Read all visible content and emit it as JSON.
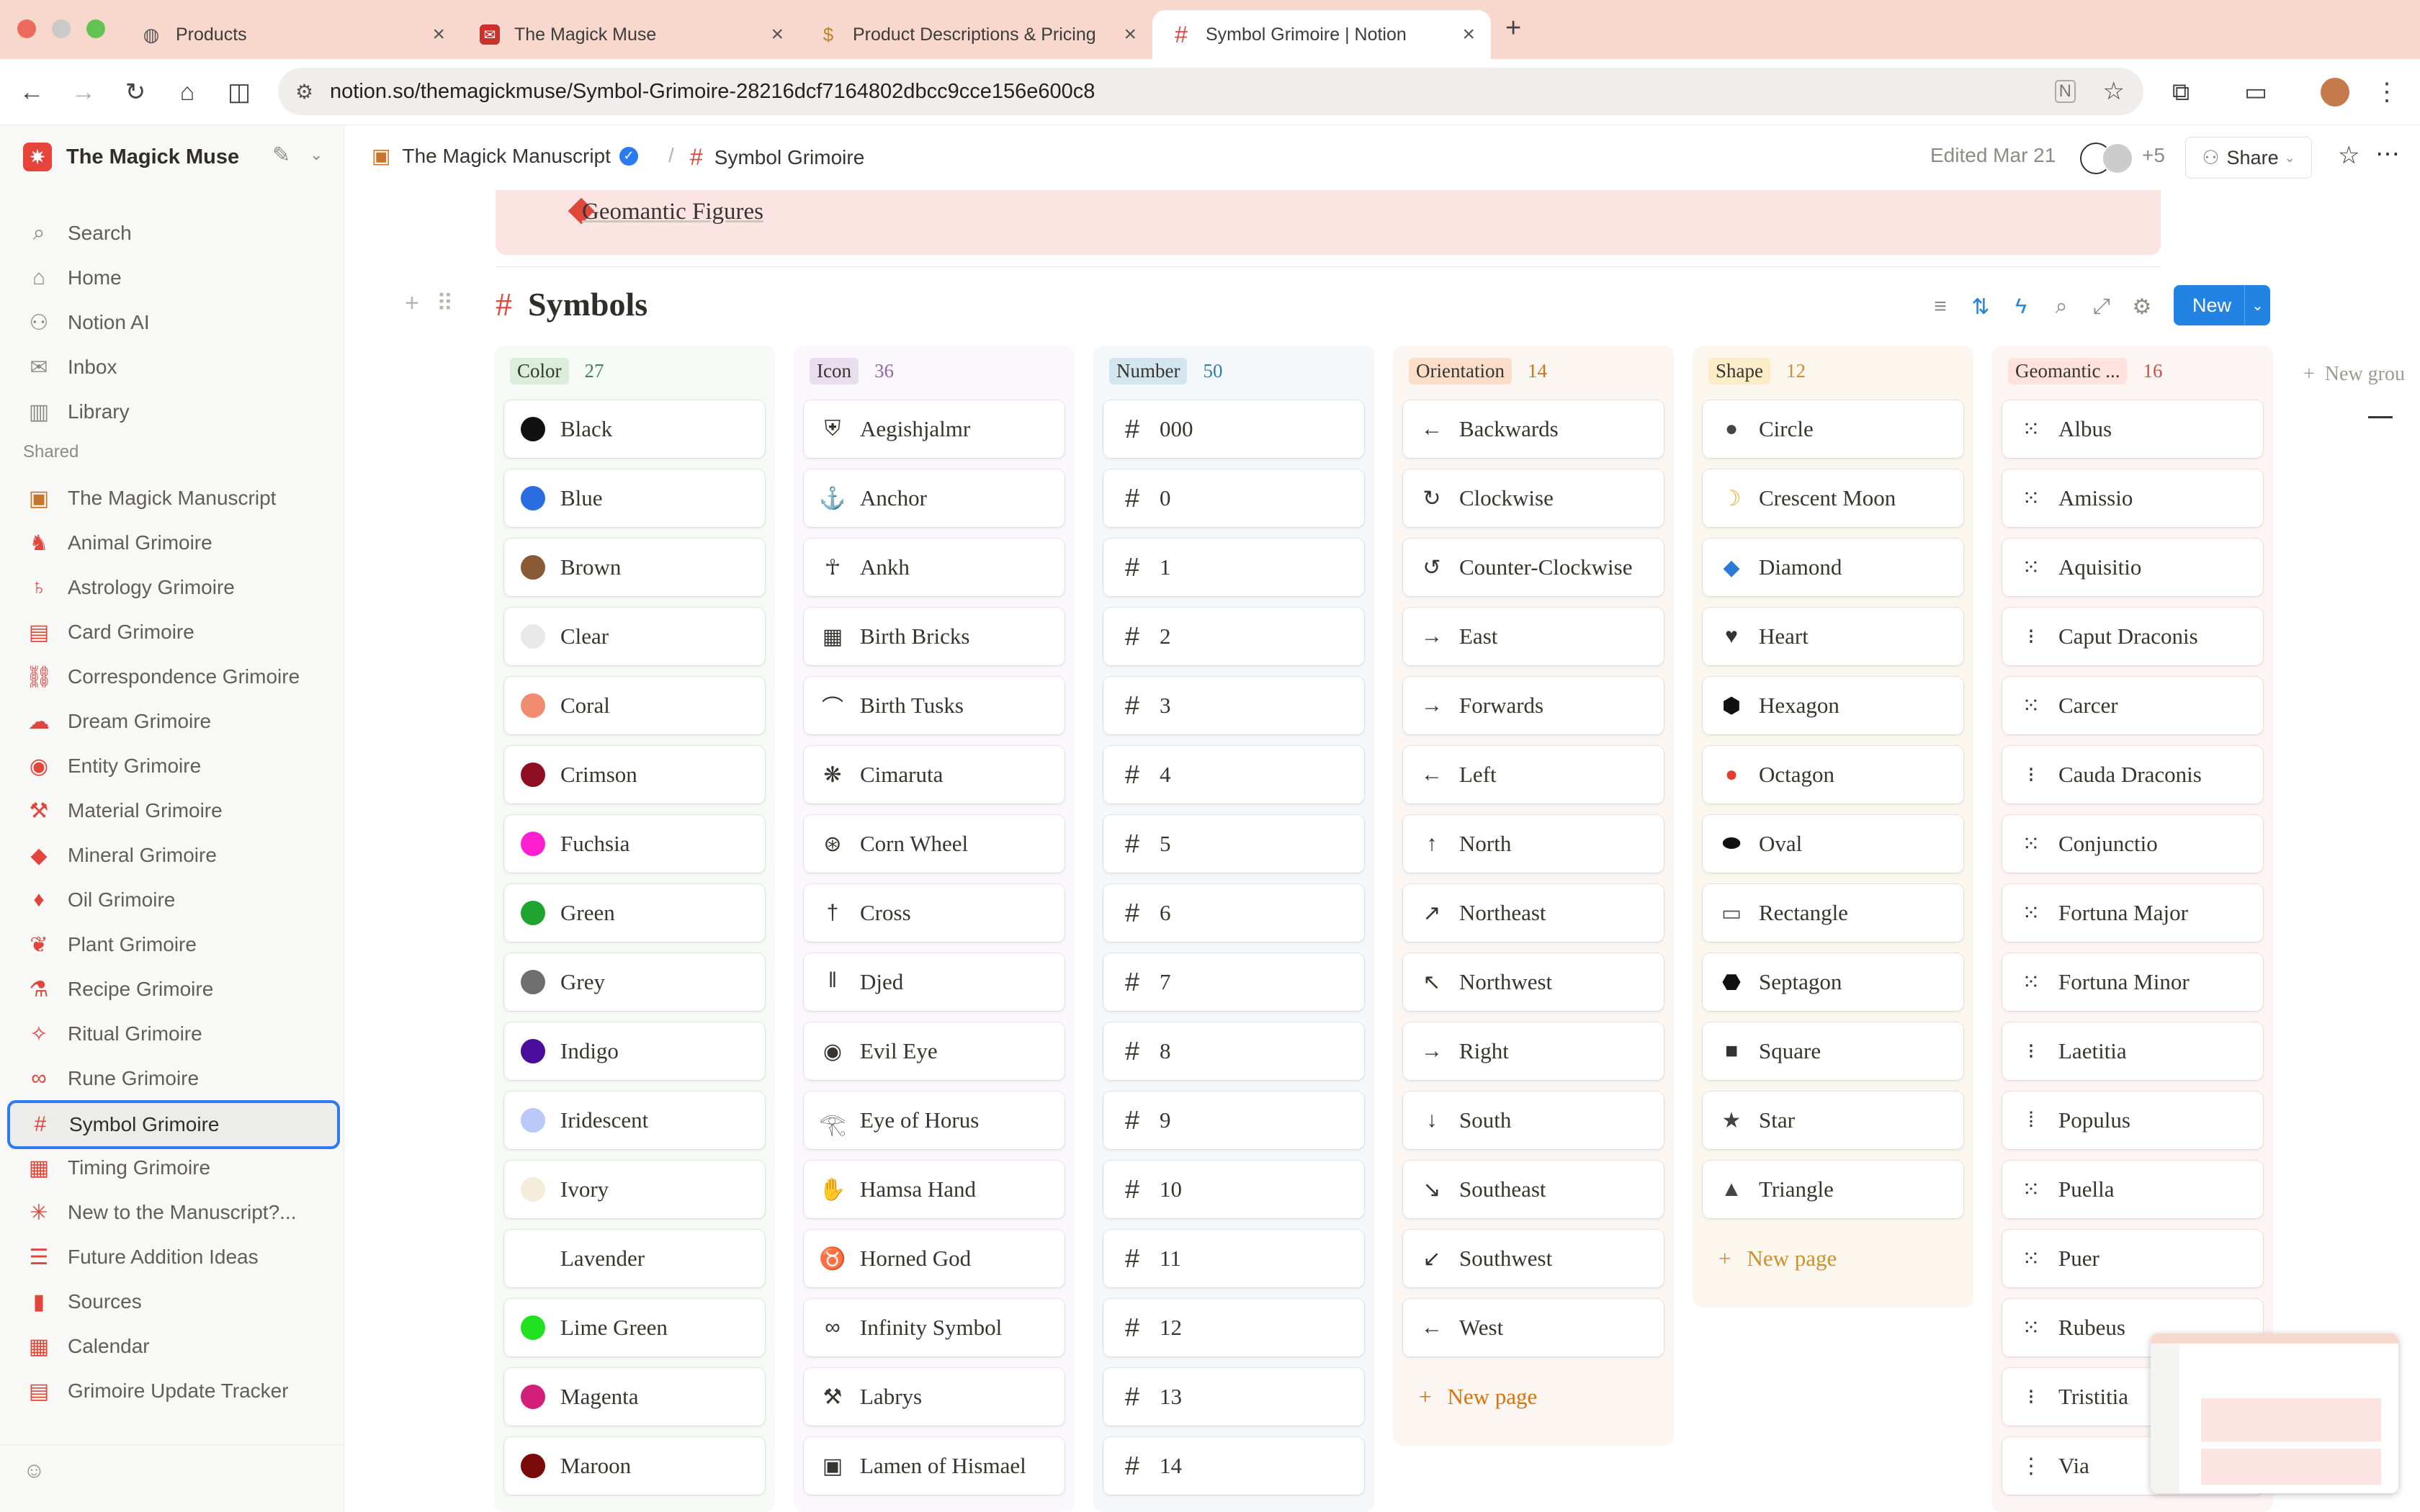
{
  "browser": {
    "tabs": [
      {
        "label": "Products",
        "icon": "globe-icon"
      },
      {
        "label": "The Magick Muse",
        "icon": "magick-muse-icon"
      },
      {
        "label": "Product Descriptions & Pricing",
        "icon": "money-bag-icon"
      },
      {
        "label": "Symbol Grimoire | Notion",
        "icon": "hash-icon"
      }
    ],
    "url": "notion.so/themagickmuse/Symbol-Grimoire-28216dcf7164802dbcc9cce156e600c8"
  },
  "sidebar": {
    "workspace": "The Magick Muse",
    "nav": [
      {
        "label": "Search",
        "icon": "search-icon"
      },
      {
        "label": "Home",
        "icon": "home-icon"
      },
      {
        "label": "Notion AI",
        "icon": "notion-ai-icon"
      },
      {
        "label": "Inbox",
        "icon": "inbox-icon"
      },
      {
        "label": "Library",
        "icon": "library-icon"
      }
    ],
    "shared_label": "Shared",
    "shared": [
      {
        "label": "The Magick Manuscript",
        "icon": "treasure-chest-icon"
      },
      {
        "label": "Animal Grimoire",
        "icon": "animal-icon"
      },
      {
        "label": "Astrology Grimoire",
        "icon": "planet-icon"
      },
      {
        "label": "Card Grimoire",
        "icon": "cards-icon"
      },
      {
        "label": "Correspondence Grimoire",
        "icon": "link-icon"
      },
      {
        "label": "Dream Grimoire",
        "icon": "cloud-icon"
      },
      {
        "label": "Entity Grimoire",
        "icon": "eye-icon"
      },
      {
        "label": "Material Grimoire",
        "icon": "wrench-icon"
      },
      {
        "label": "Mineral Grimoire",
        "icon": "gem-icon"
      },
      {
        "label": "Oil Grimoire",
        "icon": "drop-icon"
      },
      {
        "label": "Plant Grimoire",
        "icon": "leaf-icon"
      },
      {
        "label": "Recipe Grimoire",
        "icon": "flask-icon"
      },
      {
        "label": "Ritual Grimoire",
        "icon": "wand-icon"
      },
      {
        "label": "Rune Grimoire",
        "icon": "infinity-icon"
      },
      {
        "label": "Symbol Grimoire",
        "icon": "hash-icon"
      },
      {
        "label": "Timing Grimoire",
        "icon": "calendar-icon"
      },
      {
        "label": "New to the Manuscript?...",
        "icon": "sparkle-icon"
      },
      {
        "label": "Future Addition Ideas",
        "icon": "list-icon"
      },
      {
        "label": "Sources",
        "icon": "book-icon"
      },
      {
        "label": "Calendar",
        "icon": "calendar-icon"
      },
      {
        "label": "Grimoire Update Tracker",
        "icon": "tracker-icon"
      }
    ]
  },
  "header": {
    "crumb1": "The Magick Manuscript",
    "crumb_sep": "/",
    "crumb2": "Symbol Grimoire",
    "edited": "Edited Mar 21",
    "avatars_more": "+5",
    "share": "Share"
  },
  "callout_item": "Geomantic Figures",
  "database": {
    "title": "Symbols",
    "new_label": "New",
    "new_group": "New grou",
    "new_page": "New page",
    "columns": [
      {
        "name": "Color",
        "count": "27",
        "pill_bg": "#dbeddb",
        "bg": "#f6faf6",
        "count_color": "#448361",
        "items": [
          {
            "label": "Black",
            "swatch": "#111111"
          },
          {
            "label": "Blue",
            "swatch": "#2a6de0"
          },
          {
            "label": "Brown",
            "swatch": "#8a5a34"
          },
          {
            "label": "Clear",
            "swatch": "#e9e9ea"
          },
          {
            "label": "Coral",
            "swatch": "#f08d70"
          },
          {
            "label": "Crimson",
            "swatch": "#8d0e22"
          },
          {
            "label": "Fuchsia",
            "swatch": "#ff1ed0"
          },
          {
            "label": "Green",
            "swatch": "#1fa331"
          },
          {
            "label": "Grey",
            "swatch": "#6e6e6e"
          },
          {
            "label": "Indigo",
            "swatch": "#4a0c9a"
          },
          {
            "label": "Iridescent",
            "swatch": "#b9c8f7"
          },
          {
            "label": "Ivory",
            "swatch": "#f5ecdc"
          },
          {
            "label": "Lavender",
            "swatch": ""
          },
          {
            "label": "Lime Green",
            "swatch": "#1fe11f"
          },
          {
            "label": "Magenta",
            "swatch": "#d11e78"
          },
          {
            "label": "Maroon",
            "swatch": "#7a0b0b"
          }
        ]
      },
      {
        "name": "Icon",
        "count": "36",
        "pill_bg": "#e8deee",
        "bg": "#faf8fc",
        "count_color": "#9065b0",
        "items": [
          {
            "label": "Aegishjalmr",
            "glyph": "⛨"
          },
          {
            "label": "Anchor",
            "glyph": "⚓"
          },
          {
            "label": "Ankh",
            "glyph": "☥"
          },
          {
            "label": "Birth Bricks",
            "glyph": "▦"
          },
          {
            "label": "Birth Tusks",
            "glyph": "⌒"
          },
          {
            "label": "Cimaruta",
            "glyph": "❋"
          },
          {
            "label": "Corn Wheel",
            "glyph": "⊛"
          },
          {
            "label": "Cross",
            "glyph": "†"
          },
          {
            "label": "Djed",
            "glyph": "𝍪"
          },
          {
            "label": "Evil Eye",
            "glyph": "◉"
          },
          {
            "label": "Eye of Horus",
            "glyph": "𓂀"
          },
          {
            "label": "Hamsa Hand",
            "glyph": "✋"
          },
          {
            "label": "Horned God",
            "glyph": "♉"
          },
          {
            "label": "Infinity Symbol",
            "glyph": "∞"
          },
          {
            "label": "Labrys",
            "glyph": "⚒"
          },
          {
            "label": "Lamen of Hismael",
            "glyph": "▣"
          }
        ]
      },
      {
        "name": "Number",
        "count": "50",
        "pill_bg": "#d3e5ef",
        "bg": "#f4f8fb",
        "count_color": "#337ea9",
        "items": [
          "000",
          "0",
          "1",
          "2",
          "3",
          "4",
          "5",
          "6",
          "7",
          "8",
          "9",
          "10",
          "11",
          "12",
          "13",
          "14"
        ]
      },
      {
        "name": "Orientation",
        "count": "14",
        "pill_bg": "#fadec9",
        "bg": "#fcf6f2",
        "count_color": "#d9730d",
        "items": [
          {
            "label": "Backwards",
            "glyph": "←"
          },
          {
            "label": "Clockwise",
            "glyph": "↻"
          },
          {
            "label": "Counter-Clockwise",
            "glyph": "↺"
          },
          {
            "label": "East",
            "glyph": "→"
          },
          {
            "label": "Forwards",
            "glyph": "→"
          },
          {
            "label": "Left",
            "glyph": "←"
          },
          {
            "label": "North",
            "glyph": "↑"
          },
          {
            "label": "Northeast",
            "glyph": "↗"
          },
          {
            "label": "Northwest",
            "glyph": "↖"
          },
          {
            "label": "Right",
            "glyph": "→"
          },
          {
            "label": "South",
            "glyph": "↓"
          },
          {
            "label": "Southeast",
            "glyph": "↘"
          },
          {
            "label": "Southwest",
            "glyph": "↙"
          },
          {
            "label": "West",
            "glyph": "←"
          }
        ]
      },
      {
        "name": "Shape",
        "count": "12",
        "pill_bg": "#fdecc8",
        "bg": "#fbf7ee",
        "count_color": "#cb912f",
        "items": [
          {
            "label": "Circle",
            "glyph": "●",
            "color": "#444444"
          },
          {
            "label": "Crescent Moon",
            "glyph": "☽",
            "color": "#e6b422"
          },
          {
            "label": "Diamond",
            "glyph": "◆",
            "color": "#2a7ad6"
          },
          {
            "label": "Heart",
            "glyph": "♥",
            "color": "#333333"
          },
          {
            "label": "Hexagon",
            "glyph": "⬢",
            "color": "#111111"
          },
          {
            "label": "Octagon",
            "glyph": "●",
            "color": "#e33b2e"
          },
          {
            "label": "Oval",
            "glyph": "⬬",
            "color": "#111111"
          },
          {
            "label": "Rectangle",
            "glyph": "▭",
            "color": "#555555"
          },
          {
            "label": "Septagon",
            "glyph": "⬣",
            "color": "#111111"
          },
          {
            "label": "Square",
            "glyph": "■",
            "color": "#333333"
          },
          {
            "label": "Star",
            "glyph": "★",
            "color": "#444444"
          },
          {
            "label": "Triangle",
            "glyph": "▲",
            "color": "#444444"
          }
        ]
      },
      {
        "name": "Geomantic ...",
        "count": "16",
        "pill_bg": "#ffe2dd",
        "bg": "#fdf5f3",
        "count_color": "#d44c47",
        "items": [
          {
            "label": "Albus",
            "glyph": "⁙"
          },
          {
            "label": "Amissio",
            "glyph": "⁙"
          },
          {
            "label": "Aquisitio",
            "glyph": "⁙"
          },
          {
            "label": "Caput Draconis",
            "glyph": "⁝"
          },
          {
            "label": "Carcer",
            "glyph": "⁙"
          },
          {
            "label": "Cauda Draconis",
            "glyph": "⁝"
          },
          {
            "label": "Conjunctio",
            "glyph": "⁙"
          },
          {
            "label": "Fortuna Major",
            "glyph": "⁙"
          },
          {
            "label": "Fortuna Minor",
            "glyph": "⁙"
          },
          {
            "label": "Laetitia",
            "glyph": "⁝"
          },
          {
            "label": "Populus",
            "glyph": "⁞"
          },
          {
            "label": "Puella",
            "glyph": "⁙"
          },
          {
            "label": "Puer",
            "glyph": "⁙"
          },
          {
            "label": "Rubeus",
            "glyph": "⁙"
          },
          {
            "label": "Tristitia",
            "glyph": "⁝"
          },
          {
            "label": "Via",
            "glyph": "⋮"
          }
        ]
      }
    ]
  }
}
